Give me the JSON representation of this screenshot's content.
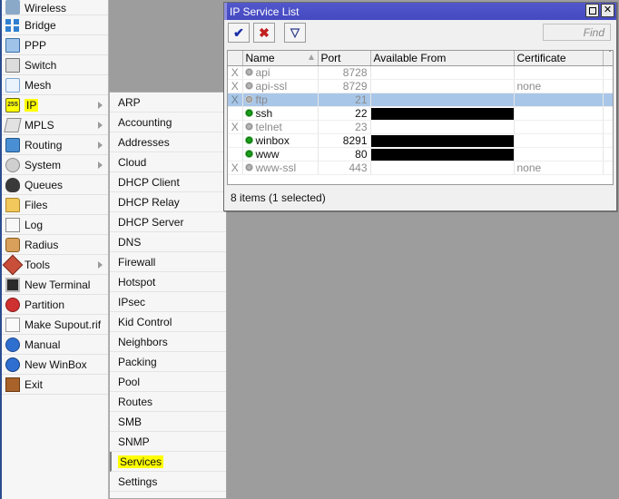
{
  "sidebar": {
    "items": [
      {
        "label": "Wireless",
        "icon": "wireless-icon",
        "submenu": false,
        "highlight": false
      },
      {
        "label": "Bridge",
        "icon": "bridge-icon",
        "submenu": false,
        "highlight": false
      },
      {
        "label": "PPP",
        "icon": "ppp-icon",
        "submenu": false,
        "highlight": false
      },
      {
        "label": "Switch",
        "icon": "switch-icon",
        "submenu": false,
        "highlight": false
      },
      {
        "label": "Mesh",
        "icon": "mesh-icon",
        "submenu": false,
        "highlight": false
      },
      {
        "label": "IP",
        "icon": "ip-icon",
        "submenu": true,
        "highlight": true
      },
      {
        "label": "MPLS",
        "icon": "mpls-icon",
        "submenu": true,
        "highlight": false
      },
      {
        "label": "Routing",
        "icon": "routing-icon",
        "submenu": true,
        "highlight": false
      },
      {
        "label": "System",
        "icon": "system-icon",
        "submenu": true,
        "highlight": false
      },
      {
        "label": "Queues",
        "icon": "queues-icon",
        "submenu": false,
        "highlight": false
      },
      {
        "label": "Files",
        "icon": "files-icon",
        "submenu": false,
        "highlight": false
      },
      {
        "label": "Log",
        "icon": "log-icon",
        "submenu": false,
        "highlight": false
      },
      {
        "label": "Radius",
        "icon": "radius-icon",
        "submenu": false,
        "highlight": false
      },
      {
        "label": "Tools",
        "icon": "tools-icon",
        "submenu": true,
        "highlight": false
      },
      {
        "label": "New Terminal",
        "icon": "terminal-icon",
        "submenu": false,
        "highlight": false
      },
      {
        "label": "Partition",
        "icon": "partition-icon",
        "submenu": false,
        "highlight": false
      },
      {
        "label": "Make Supout.rif",
        "icon": "supout-icon",
        "submenu": false,
        "highlight": false
      },
      {
        "label": "Manual",
        "icon": "manual-icon",
        "submenu": false,
        "highlight": false
      },
      {
        "label": "New WinBox",
        "icon": "winbox-icon",
        "submenu": false,
        "highlight": false
      },
      {
        "label": "Exit",
        "icon": "exit-icon",
        "submenu": false,
        "highlight": false
      }
    ]
  },
  "submenu": {
    "parent": "IP",
    "items": [
      {
        "label": "ARP",
        "highlight": false
      },
      {
        "label": "Accounting",
        "highlight": false
      },
      {
        "label": "Addresses",
        "highlight": false
      },
      {
        "label": "Cloud",
        "highlight": false
      },
      {
        "label": "DHCP Client",
        "highlight": false
      },
      {
        "label": "DHCP Relay",
        "highlight": false
      },
      {
        "label": "DHCP Server",
        "highlight": false
      },
      {
        "label": "DNS",
        "highlight": false
      },
      {
        "label": "Firewall",
        "highlight": false
      },
      {
        "label": "Hotspot",
        "highlight": false
      },
      {
        "label": "IPsec",
        "highlight": false
      },
      {
        "label": "Kid Control",
        "highlight": false
      },
      {
        "label": "Neighbors",
        "highlight": false
      },
      {
        "label": "Packing",
        "highlight": false
      },
      {
        "label": "Pool",
        "highlight": false
      },
      {
        "label": "Routes",
        "highlight": false
      },
      {
        "label": "SMB",
        "highlight": false
      },
      {
        "label": "SNMP",
        "highlight": false
      },
      {
        "label": "Services",
        "highlight": true
      },
      {
        "label": "Settings",
        "highlight": false
      }
    ]
  },
  "window": {
    "title": "IP Service List",
    "maximize_label": "□",
    "close_label": "✕",
    "toolbar": {
      "enable_label": "✔",
      "disable_label": "✖",
      "filter_label": "▽"
    },
    "find": {
      "value": "",
      "placeholder": "Find"
    },
    "table": {
      "columns": [
        "",
        "Name",
        "Port",
        "Available From",
        "Certificate",
        ""
      ],
      "sort_column": "Name",
      "sort_direction": "ascending",
      "rows": [
        {
          "flag": "X",
          "name": "api",
          "port": "8728",
          "available_from": "",
          "redacted": false,
          "certificate": "",
          "enabled": false,
          "selected": false
        },
        {
          "flag": "X",
          "name": "api-ssl",
          "port": "8729",
          "available_from": "",
          "redacted": false,
          "certificate": "none",
          "enabled": false,
          "selected": false
        },
        {
          "flag": "X",
          "name": "ftp",
          "port": "21",
          "available_from": "",
          "redacted": false,
          "certificate": "",
          "enabled": false,
          "selected": true
        },
        {
          "flag": "",
          "name": "ssh",
          "port": "22",
          "available_from": "",
          "redacted": true,
          "certificate": "",
          "enabled": true,
          "selected": false
        },
        {
          "flag": "X",
          "name": "telnet",
          "port": "23",
          "available_from": "",
          "redacted": false,
          "certificate": "",
          "enabled": false,
          "selected": false
        },
        {
          "flag": "",
          "name": "winbox",
          "port": "8291",
          "available_from": "",
          "redacted": true,
          "certificate": "",
          "enabled": true,
          "selected": false
        },
        {
          "flag": "",
          "name": "www",
          "port": "80",
          "available_from": "",
          "redacted": true,
          "certificate": "",
          "enabled": true,
          "selected": false
        },
        {
          "flag": "X",
          "name": "www-ssl",
          "port": "443",
          "available_from": "",
          "redacted": false,
          "certificate": "none",
          "enabled": false,
          "selected": false
        }
      ]
    },
    "status": "8 items (1 selected)"
  },
  "colors": {
    "titlebar": "#4a50c8",
    "selection": "#a8c6e8",
    "highlight": "#ffff00",
    "enabled_dot": "#19a019",
    "disabled_dot": "#b4b4b4",
    "backdrop": "#9d9d9d"
  }
}
